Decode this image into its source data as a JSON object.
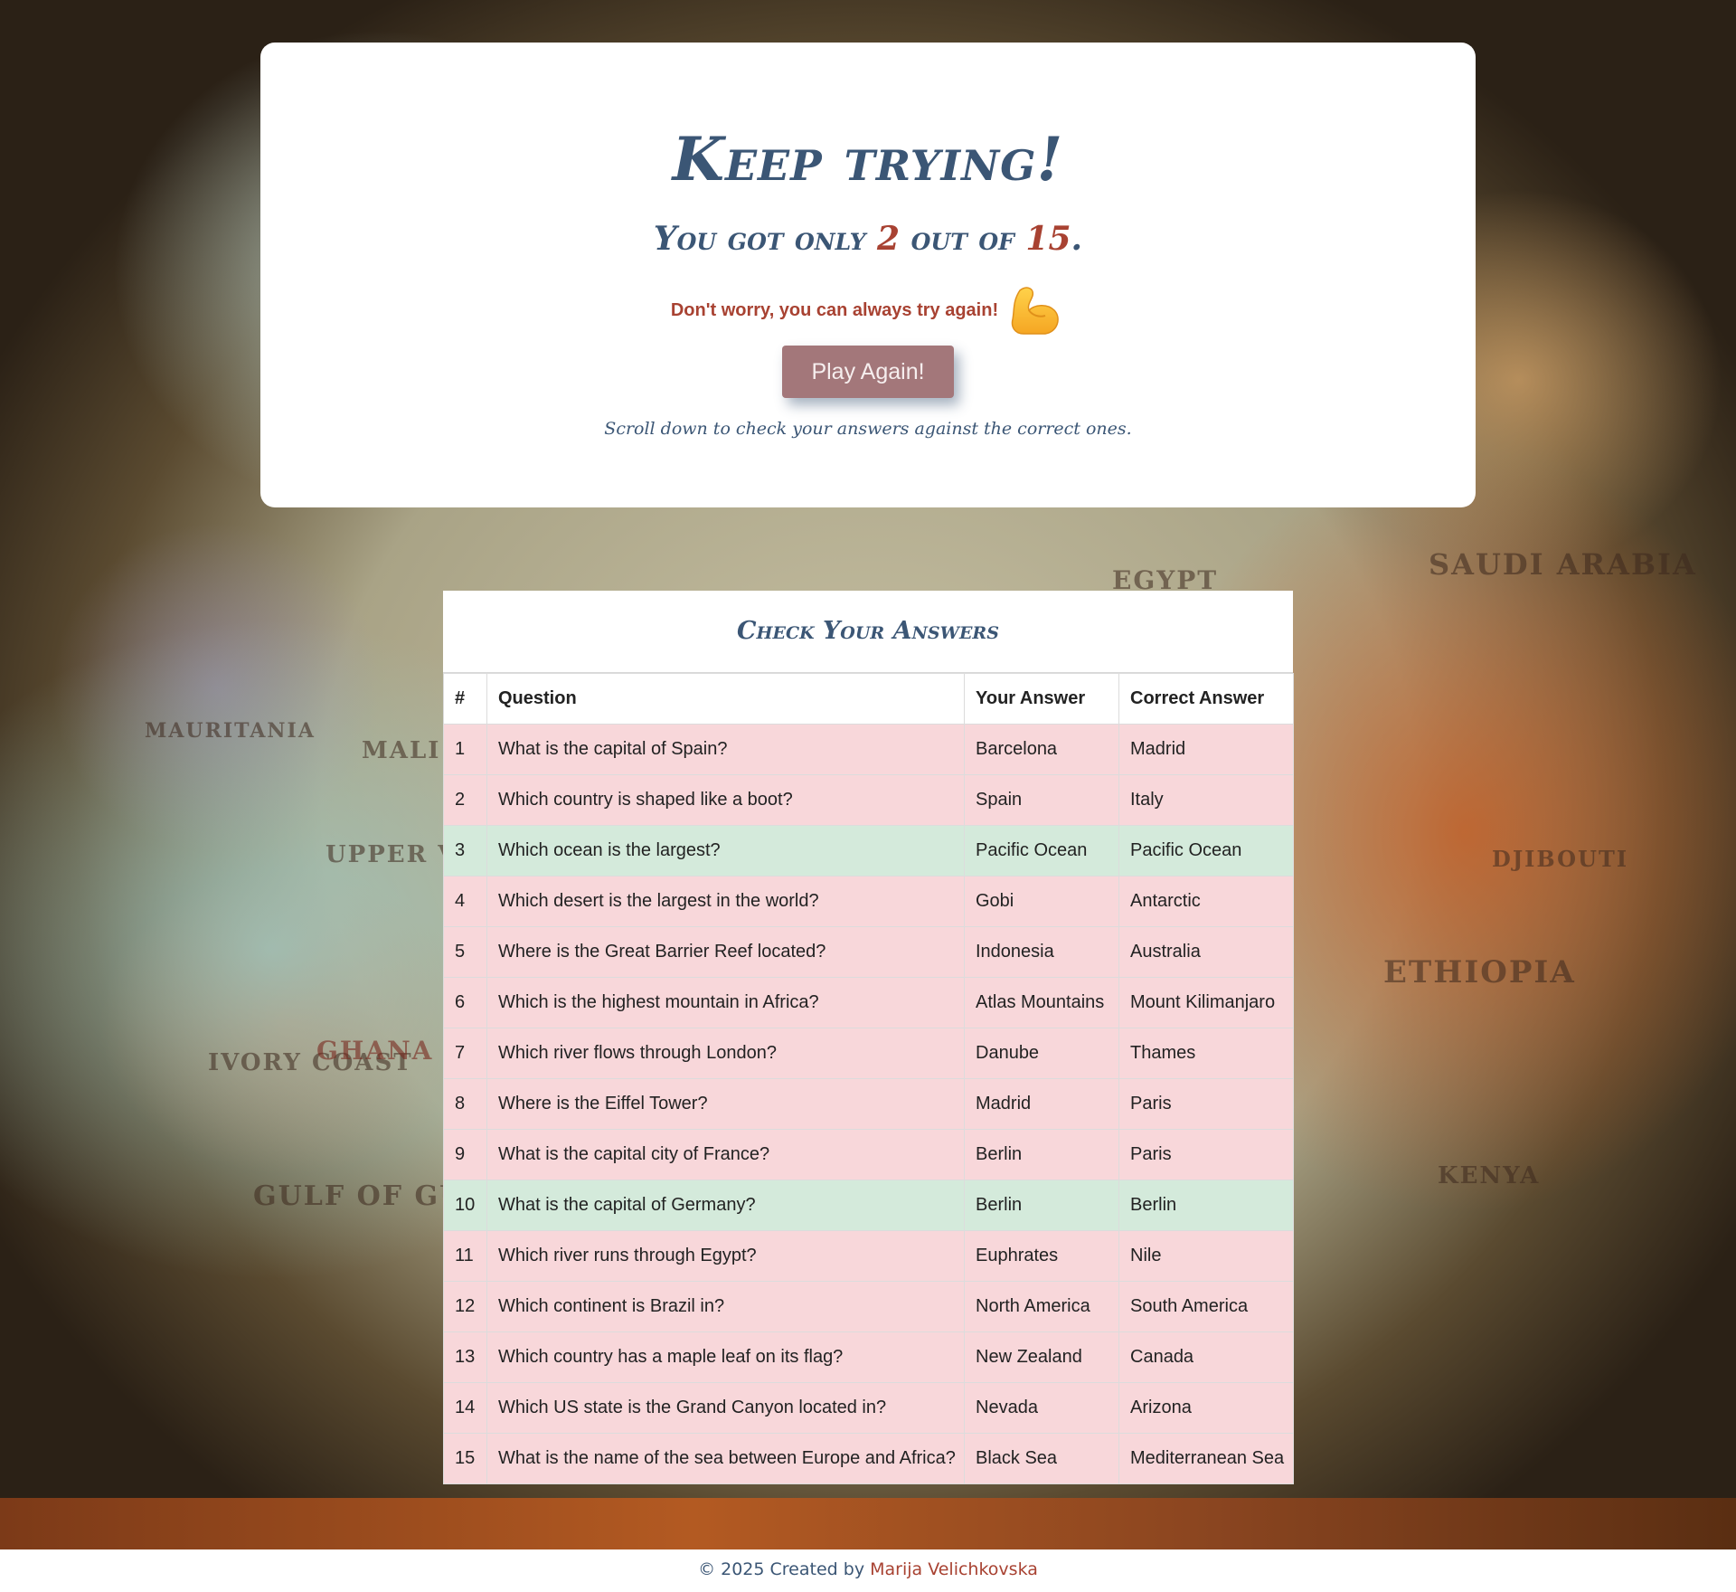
{
  "result": {
    "heading": "Keep trying!",
    "score_prefix": "You got only",
    "score": "2",
    "score_mid": "out of",
    "total": "15",
    "score_suffix": ".",
    "message": "Don't worry, you can always try again!",
    "message_icon": "flexed-biceps-icon",
    "play_again_label": "Play Again!",
    "hint": "Scroll down to check your answers against the correct ones."
  },
  "answers": {
    "title": "Check Your Answers",
    "columns": [
      "#",
      "Question",
      "Your Answer",
      "Correct Answer"
    ],
    "rows": [
      {
        "n": "1",
        "question": "What is the capital of Spain?",
        "yours": "Barcelona",
        "correct": "Madrid",
        "is_correct": false
      },
      {
        "n": "2",
        "question": "Which country is shaped like a boot?",
        "yours": "Spain",
        "correct": "Italy",
        "is_correct": false
      },
      {
        "n": "3",
        "question": "Which ocean is the largest?",
        "yours": "Pacific Ocean",
        "correct": "Pacific Ocean",
        "is_correct": true
      },
      {
        "n": "4",
        "question": "Which desert is the largest in the world?",
        "yours": "Gobi",
        "correct": "Antarctic",
        "is_correct": false
      },
      {
        "n": "5",
        "question": "Where is the Great Barrier Reef located?",
        "yours": "Indonesia",
        "correct": "Australia",
        "is_correct": false
      },
      {
        "n": "6",
        "question": "Which is the highest mountain in Africa?",
        "yours": "Atlas Mountains",
        "correct": "Mount Kilimanjaro",
        "is_correct": false
      },
      {
        "n": "7",
        "question": "Which river flows through London?",
        "yours": "Danube",
        "correct": "Thames",
        "is_correct": false
      },
      {
        "n": "8",
        "question": "Where is the Eiffel Tower?",
        "yours": "Madrid",
        "correct": "Paris",
        "is_correct": false
      },
      {
        "n": "9",
        "question": "What is the capital city of France?",
        "yours": "Berlin",
        "correct": "Paris",
        "is_correct": false
      },
      {
        "n": "10",
        "question": "What is the capital of Germany?",
        "yours": "Berlin",
        "correct": "Berlin",
        "is_correct": true
      },
      {
        "n": "11",
        "question": "Which river runs through Egypt?",
        "yours": "Euphrates",
        "correct": "Nile",
        "is_correct": false
      },
      {
        "n": "12",
        "question": "Which continent is Brazil in?",
        "yours": "North America",
        "correct": "South America",
        "is_correct": false
      },
      {
        "n": "13",
        "question": "Which country has a maple leaf on its flag?",
        "yours": "New Zealand",
        "correct": "Canada",
        "is_correct": false
      },
      {
        "n": "14",
        "question": "Which US state is the Grand Canyon located in?",
        "yours": "Nevada",
        "correct": "Arizona",
        "is_correct": false
      },
      {
        "n": "15",
        "question": "What is the name of the sea between Europe and Africa?",
        "yours": "Black Sea",
        "correct": "Mediterranean Sea",
        "is_correct": false
      }
    ]
  },
  "footer": {
    "prefix": "© 2025 Created by",
    "author": "Marija Velichkovska"
  },
  "background_labels": [
    "MAURITANIA",
    "MALI",
    "UPPER VOLTA",
    "IVORY COAST",
    "GHANA",
    "GULF OF GUINEA",
    "EGYPT",
    "SAUDI ARABIA",
    "ETHIOPIA",
    "KENYA",
    "DJIBOUTI"
  ],
  "colors": {
    "heading": "#3b5675",
    "accent": "#a84232",
    "button": "#a3777a",
    "wrong_row": "#f8d7da",
    "right_row": "#d4eadb"
  }
}
